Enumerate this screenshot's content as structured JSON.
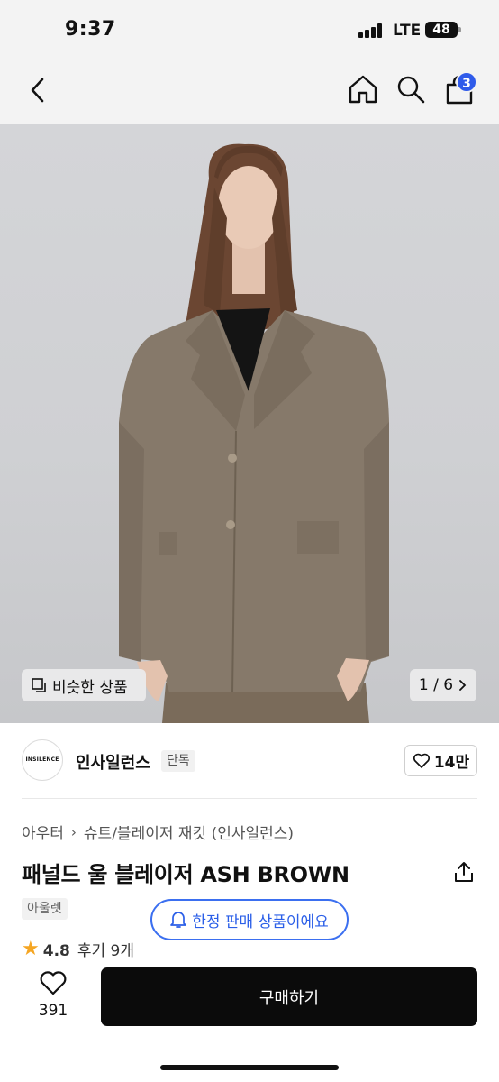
{
  "status_bar": {
    "time": "9:37",
    "network": "LTE",
    "battery": "48"
  },
  "nav": {
    "back_icon": "chevron-left-icon",
    "home_icon": "home-icon",
    "search_icon": "search-icon",
    "cart_icon": "shopping-bag-icon",
    "cart_count": "3"
  },
  "gallery": {
    "similar_label": "비슷한 상품",
    "page_indicator": "1 / 6"
  },
  "brand": {
    "logo_text": "INSILENCE",
    "name": "인사일런스",
    "tag": "단독",
    "likes": "14만"
  },
  "breadcrumb": [
    "아우터",
    "슈트/블레이저 재킷 (인사일런스)"
  ],
  "product": {
    "title": "패널드 울 블레이저 ASH BROWN",
    "badge": "아울렛",
    "limited_notice": "한정 판매 상품이에요"
  },
  "rating": {
    "score": "4.8",
    "reviews": "후기 9개"
  },
  "bottom_bar": {
    "wish_count": "391",
    "buy_label": "구매하기"
  },
  "colors": {
    "accent_blue": "#2f5bea",
    "buy_button": "#0b0b0b",
    "star": "#f5a623"
  }
}
